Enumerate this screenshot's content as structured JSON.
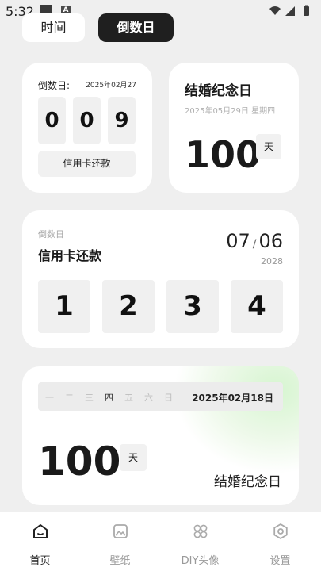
{
  "status_bar": {
    "time": "5:32"
  },
  "tabs": [
    {
      "label": "时间"
    },
    {
      "label": "倒数日"
    }
  ],
  "countdown_card": {
    "label": "倒数日:",
    "date": "2025年02月27",
    "digits": [
      "0",
      "0",
      "9"
    ],
    "button": "信用卡还款"
  },
  "anniversary_card": {
    "title": "结婚纪念日",
    "subtitle": "2025年05月29日 星期四",
    "number": "100",
    "unit": "天"
  },
  "wide_card": {
    "label": "倒数日",
    "title": "信用卡还款",
    "month": "07",
    "separator": "/",
    "day": "06",
    "year": "2028",
    "digits": [
      "1",
      "2",
      "3",
      "4"
    ]
  },
  "week_card": {
    "weekdays": [
      "一",
      "二",
      "三",
      "四",
      "五",
      "六",
      "日"
    ],
    "active_weekday": "四",
    "date": "2025年02月18日",
    "number": "100",
    "unit": "天",
    "name": "结婚纪念日"
  },
  "nav": [
    {
      "label": "首页",
      "icon": "home-icon",
      "active": true
    },
    {
      "label": "壁纸",
      "icon": "wallpaper-icon",
      "active": false
    },
    {
      "label": "DIY头像",
      "icon": "diy-avatar-icon",
      "active": false
    },
    {
      "label": "设置",
      "icon": "settings-icon",
      "active": false
    }
  ],
  "colors": {
    "background": "#efefef",
    "accent_dark": "#1f1f1f",
    "card": "#ffffff",
    "gradient_green": "#d6f5d0"
  }
}
